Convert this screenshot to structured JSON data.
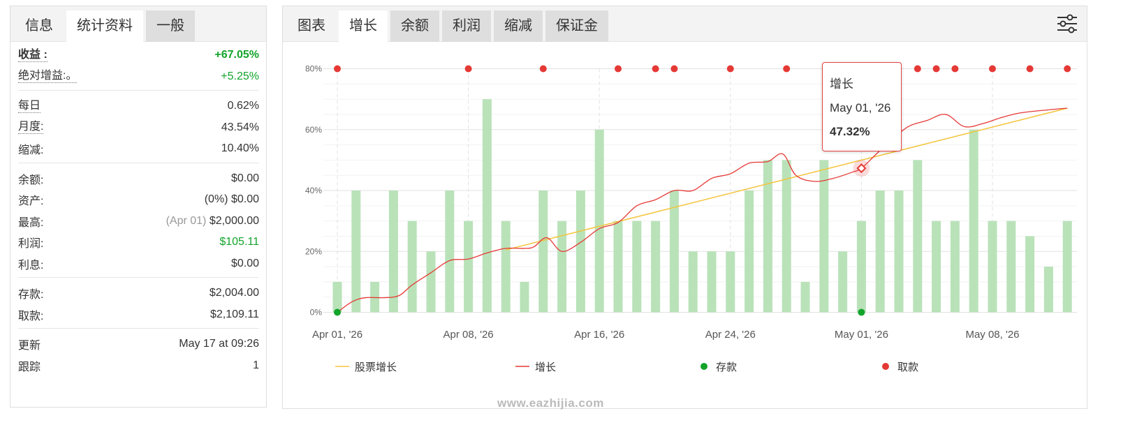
{
  "left": {
    "tabs": [
      "信息",
      "统计资料",
      "一般"
    ],
    "gain_label": "收益 :",
    "gain_value": "+67.05%",
    "abs_gain_label": "绝对增益:。",
    "abs_gain_value": "+5.25%",
    "daily_label": "每日",
    "daily_value": "0.62%",
    "monthly_label": "月度:",
    "monthly_value": "43.54%",
    "drawdown_label": "缩减:",
    "drawdown_value": "10.40%",
    "balance_label": "余额:",
    "balance_value": "$0.00",
    "equity_label": "资产:",
    "equity_pct": "(0%)",
    "equity_value": "$0.00",
    "highest_label": "最高:",
    "highest_date": "(Apr 01)",
    "highest_value": "$2,000.00",
    "profit_label": "利润:",
    "profit_value": "$105.11",
    "interest_label": "利息:",
    "interest_value": "$0.00",
    "deposits_label": "存款:",
    "deposits_value": "$2,004.00",
    "withdrawals_label": "取款:",
    "withdrawals_value": "$2,109.11",
    "updated_label": "更新",
    "updated_value": "May 17 at 09:26",
    "tracking_label": "跟踪",
    "tracking_value": "1"
  },
  "right": {
    "tabs": [
      "图表",
      "增长",
      "余额",
      "利润",
      "缩减",
      "保证金"
    ],
    "settings_icon": "sliders-icon",
    "tooltip": {
      "title": "增长",
      "date": "May 01, '26",
      "value": "47.32%"
    }
  },
  "watermark": "www.eazhijia.com",
  "chart_data": {
    "type": "bar",
    "y_ticks": [
      "0%",
      "20%",
      "40%",
      "60%",
      "80%"
    ],
    "ylim": [
      0,
      80
    ],
    "x_tick_labels": [
      "Apr 01, '26",
      "Apr 08, '26",
      "Apr 16, '26",
      "Apr 24, '26",
      "May 01, '26",
      "May 08, '26"
    ],
    "x_tick_indices": [
      0,
      7,
      14,
      21,
      28,
      35
    ],
    "grid": true,
    "legend_position": "bottom",
    "bars": [
      10,
      40,
      10,
      40,
      30,
      20,
      40,
      30,
      70,
      30,
      10,
      40,
      30,
      40,
      60,
      30,
      30,
      30,
      40,
      20,
      20,
      20,
      40,
      50,
      50,
      10,
      50,
      20,
      30,
      40,
      40,
      50,
      30,
      30,
      60,
      30,
      30,
      25,
      15,
      30
    ],
    "series": [
      {
        "name": "股票增长",
        "color": "#f5c33b",
        "points": [
          [
            9,
            20.5
          ],
          [
            39,
            67.05
          ]
        ]
      },
      {
        "name": "增长",
        "color": "#e53935",
        "points": [
          [
            0,
            0
          ],
          [
            0.8,
            3.5
          ],
          [
            1.5,
            4.8
          ],
          [
            2.5,
            4.8
          ],
          [
            3.3,
            5.5
          ],
          [
            4,
            9
          ],
          [
            5,
            13
          ],
          [
            6,
            17
          ],
          [
            7,
            17.5
          ],
          [
            8,
            19.5
          ],
          [
            9,
            21
          ],
          [
            10,
            21
          ],
          [
            10.5,
            21.5
          ],
          [
            11.2,
            24.5
          ],
          [
            12,
            20
          ],
          [
            13,
            23
          ],
          [
            14,
            27.5
          ],
          [
            15,
            29.5
          ],
          [
            16,
            35
          ],
          [
            17,
            37
          ],
          [
            18,
            40
          ],
          [
            19,
            40
          ],
          [
            20,
            44
          ],
          [
            21,
            45.5
          ],
          [
            22,
            49
          ],
          [
            23,
            49.5
          ],
          [
            23.8,
            52
          ],
          [
            24.5,
            45
          ],
          [
            25.5,
            43
          ],
          [
            26.5,
            44
          ],
          [
            27.5,
            46
          ],
          [
            28,
            47.32
          ],
          [
            28.8,
            52
          ],
          [
            29.5,
            56
          ],
          [
            30.5,
            61
          ],
          [
            31.5,
            63
          ],
          [
            32.5,
            65
          ],
          [
            33.5,
            61
          ],
          [
            34.5,
            62
          ],
          [
            35.5,
            64
          ],
          [
            36.5,
            65.5
          ],
          [
            38,
            66.5
          ],
          [
            39,
            67.05
          ]
        ]
      },
      {
        "name": "存款",
        "color": "#12a42b",
        "markers": [
          [
            0,
            0
          ],
          [
            28,
            0
          ]
        ]
      },
      {
        "name": "取款",
        "color": "#e53935",
        "markers": [
          [
            0,
            80
          ],
          [
            7,
            80
          ],
          [
            11,
            80
          ],
          [
            15,
            80
          ],
          [
            17,
            80
          ],
          [
            18,
            80
          ],
          [
            21,
            80
          ],
          [
            24,
            80
          ],
          [
            31,
            80
          ],
          [
            32,
            80
          ],
          [
            33,
            80
          ],
          [
            35,
            80
          ],
          [
            37,
            80
          ],
          [
            39,
            80
          ]
        ]
      }
    ]
  }
}
